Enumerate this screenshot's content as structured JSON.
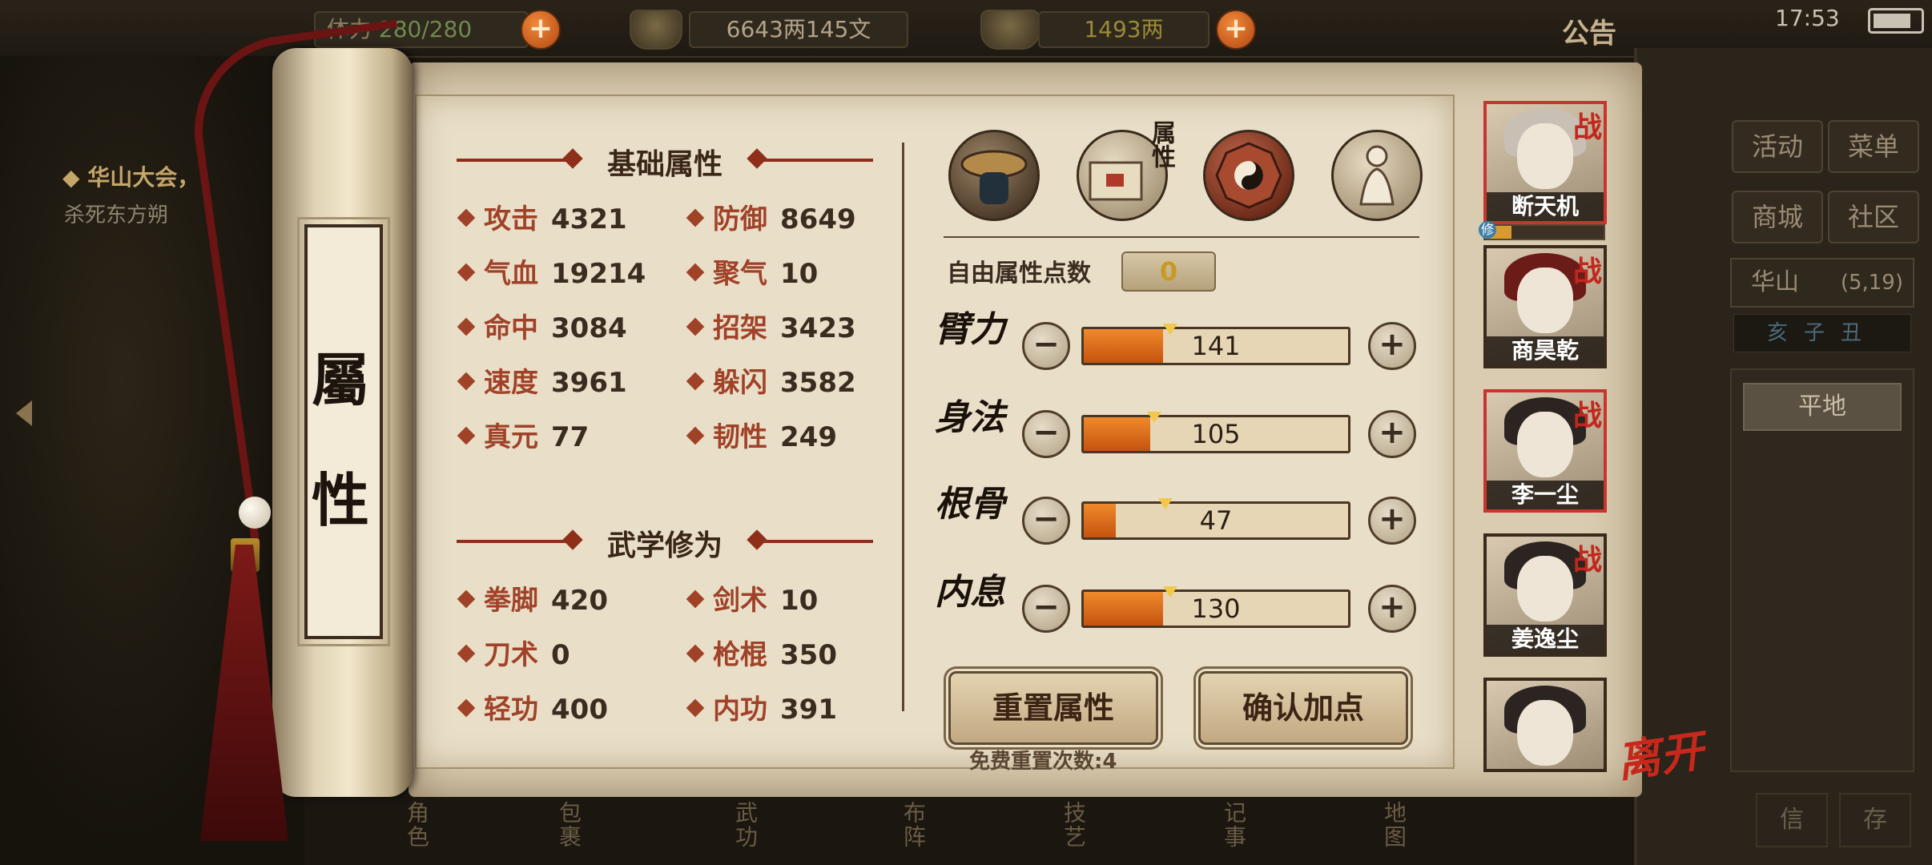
{
  "topbar": {
    "stamina_label": "体力",
    "stamina_value": "280/280",
    "money": "6643两145文",
    "gold": "1493两",
    "announcement": "公告",
    "time": "17:53"
  },
  "quest": {
    "title": "华山大会，",
    "subtitle": "杀死东方朔"
  },
  "right_menu": {
    "buttons": [
      "活动",
      "菜单",
      "商城",
      "社区"
    ],
    "location_name": "华山",
    "location_coords": "(5,19)",
    "compass": "亥子丑",
    "terrain": "平地",
    "bottom_left": "信",
    "bottom_right": "存"
  },
  "bottom_nav": [
    "角色",
    "包裹",
    "武功",
    "布阵",
    "技艺",
    "记事",
    "地图"
  ],
  "scroll_title": [
    "屬",
    "性"
  ],
  "basic": {
    "title": "基础属性",
    "stats": [
      {
        "label": "攻击",
        "value": "4321"
      },
      {
        "label": "防御",
        "value": "8649"
      },
      {
        "label": "气血",
        "value": "19214"
      },
      {
        "label": "聚气",
        "value": "10"
      },
      {
        "label": "命中",
        "value": "3084"
      },
      {
        "label": "招架",
        "value": "3423"
      },
      {
        "label": "速度",
        "value": "3961"
      },
      {
        "label": "躲闪",
        "value": "3582"
      },
      {
        "label": "真元",
        "value": "77"
      },
      {
        "label": "韧性",
        "value": "249"
      }
    ]
  },
  "martial": {
    "title": "武学修为",
    "stats": [
      {
        "label": "拳脚",
        "value": "420"
      },
      {
        "label": "剑术",
        "value": "10"
      },
      {
        "label": "刀术",
        "value": "0"
      },
      {
        "label": "枪棍",
        "value": "350"
      },
      {
        "label": "轻功",
        "value": "400"
      },
      {
        "label": "内功",
        "value": "391"
      }
    ]
  },
  "tab_icons": {
    "attr_label": "属性"
  },
  "free_points": {
    "label": "自由属性点数",
    "value": "0"
  },
  "attributes": [
    {
      "name": "臂力",
      "value": "141",
      "fill": 0.3
    },
    {
      "name": "身法",
      "value": "105",
      "fill": 0.25
    },
    {
      "name": "根骨",
      "value": "47",
      "fill": 0.12
    },
    {
      "name": "内息",
      "value": "130",
      "fill": 0.3
    }
  ],
  "buttons": {
    "reset": "重置属性",
    "confirm": "确认加点",
    "free_reset": "免费重置次数:4"
  },
  "party": [
    {
      "name": "断天机",
      "battle": "战",
      "exp_tag": "修"
    },
    {
      "name": "商昊乾",
      "battle": "战"
    },
    {
      "name": "李一尘",
      "battle": "战"
    },
    {
      "name": "姜逸尘",
      "battle": "战"
    },
    {
      "name": "",
      "battle": ""
    }
  ],
  "leave": "离开"
}
